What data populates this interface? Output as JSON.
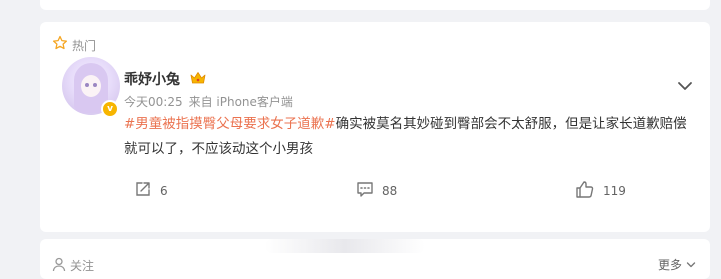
{
  "hot_section": {
    "label": "热门",
    "icon": "star-icon"
  },
  "post": {
    "username": "乖妤小兔",
    "badge_icon": "crown-icon",
    "verified_icon": "verified-badge-icon",
    "verified_symbol": "v",
    "time": "今天00:25",
    "source": "来自 iPhone客户端",
    "hashtag": "#男童被指摸臀父母要求女子道歉#",
    "text": "确实被莫名其妙碰到臀部会不太舒服，但是让家长道歉赔偿就可以了，不应该动这个小男孩",
    "menu_icon": "chevron-down-icon",
    "actions": {
      "share": {
        "icon": "share-icon",
        "count": "6"
      },
      "comment": {
        "icon": "comment-icon",
        "count": "88"
      },
      "like": {
        "icon": "thumbs-up-icon",
        "count": "119"
      }
    },
    "colors": {
      "hashtag": "#eb7350",
      "text": "#333333",
      "meta": "#939393"
    }
  },
  "follow_section": {
    "label": "关注",
    "icon": "user-icon",
    "more_label": "更多"
  }
}
